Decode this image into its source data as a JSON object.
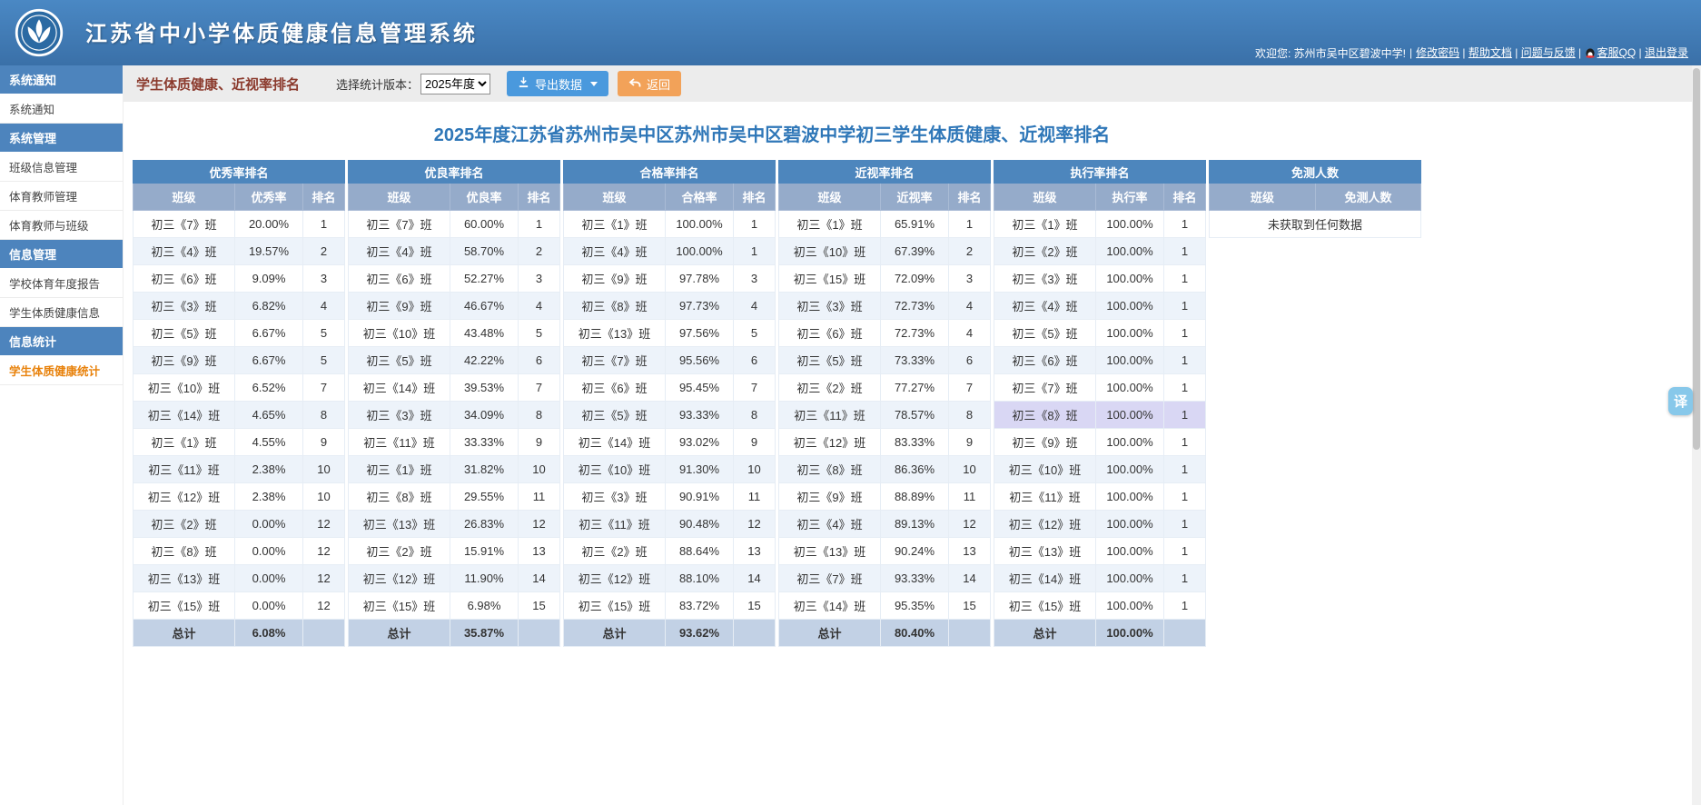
{
  "header": {
    "app_title": "江苏省中小学体质健康信息管理系统",
    "welcome": "欢迎您: 苏州市吴中区碧波中学!",
    "links": [
      "修改密码",
      "帮助文档",
      "问题与反馈",
      "客服QQ",
      "退出登录"
    ]
  },
  "sidebar": {
    "items": [
      {
        "label": "系统通知",
        "type": "group"
      },
      {
        "label": "系统通知",
        "type": "item"
      },
      {
        "label": "系统管理",
        "type": "group"
      },
      {
        "label": "班级信息管理",
        "type": "item"
      },
      {
        "label": "体育教师管理",
        "type": "item"
      },
      {
        "label": "体育教师与班级",
        "type": "item"
      },
      {
        "label": "信息管理",
        "type": "group"
      },
      {
        "label": "学校体育年度报告",
        "type": "item"
      },
      {
        "label": "学生体质健康信息",
        "type": "item"
      },
      {
        "label": "信息统计",
        "type": "group"
      },
      {
        "label": "学生体质健康统计",
        "type": "item",
        "active": true
      }
    ]
  },
  "toolbar": {
    "page_title": "学生体质健康、近视率排名",
    "version_label": "选择统计版本：",
    "version_options": [
      "2025年度"
    ],
    "version_value": "2025年度",
    "export_button": "导出数据",
    "back_button": "返回"
  },
  "main": {
    "report_title": "2025年度江苏省苏州市吴中区苏州市吴中区碧波中学初三学生体质健康、近视率排名",
    "tables": [
      {
        "title": "优秀率排名",
        "columns": [
          "班级",
          "优秀率",
          "排名"
        ],
        "rows": [
          [
            "初三《7》班",
            "20.00%",
            "1"
          ],
          [
            "初三《4》班",
            "19.57%",
            "2"
          ],
          [
            "初三《6》班",
            "9.09%",
            "3"
          ],
          [
            "初三《3》班",
            "6.82%",
            "4"
          ],
          [
            "初三《5》班",
            "6.67%",
            "5"
          ],
          [
            "初三《9》班",
            "6.67%",
            "5"
          ],
          [
            "初三《10》班",
            "6.52%",
            "7"
          ],
          [
            "初三《14》班",
            "4.65%",
            "8"
          ],
          [
            "初三《1》班",
            "4.55%",
            "9"
          ],
          [
            "初三《11》班",
            "2.38%",
            "10"
          ],
          [
            "初三《12》班",
            "2.38%",
            "10"
          ],
          [
            "初三《2》班",
            "0.00%",
            "12"
          ],
          [
            "初三《8》班",
            "0.00%",
            "12"
          ],
          [
            "初三《13》班",
            "0.00%",
            "12"
          ],
          [
            "初三《15》班",
            "0.00%",
            "12"
          ]
        ],
        "total": [
          "总计",
          "6.08%",
          ""
        ]
      },
      {
        "title": "优良率排名",
        "columns": [
          "班级",
          "优良率",
          "排名"
        ],
        "rows": [
          [
            "初三《7》班",
            "60.00%",
            "1"
          ],
          [
            "初三《4》班",
            "58.70%",
            "2"
          ],
          [
            "初三《6》班",
            "52.27%",
            "3"
          ],
          [
            "初三《9》班",
            "46.67%",
            "4"
          ],
          [
            "初三《10》班",
            "43.48%",
            "5"
          ],
          [
            "初三《5》班",
            "42.22%",
            "6"
          ],
          [
            "初三《14》班",
            "39.53%",
            "7"
          ],
          [
            "初三《3》班",
            "34.09%",
            "8"
          ],
          [
            "初三《11》班",
            "33.33%",
            "9"
          ],
          [
            "初三《1》班",
            "31.82%",
            "10"
          ],
          [
            "初三《8》班",
            "29.55%",
            "11"
          ],
          [
            "初三《13》班",
            "26.83%",
            "12"
          ],
          [
            "初三《2》班",
            "15.91%",
            "13"
          ],
          [
            "初三《12》班",
            "11.90%",
            "14"
          ],
          [
            "初三《15》班",
            "6.98%",
            "15"
          ]
        ],
        "total": [
          "总计",
          "35.87%",
          ""
        ]
      },
      {
        "title": "合格率排名",
        "columns": [
          "班级",
          "合格率",
          "排名"
        ],
        "rows": [
          [
            "初三《1》班",
            "100.00%",
            "1"
          ],
          [
            "初三《4》班",
            "100.00%",
            "1"
          ],
          [
            "初三《9》班",
            "97.78%",
            "3"
          ],
          [
            "初三《8》班",
            "97.73%",
            "4"
          ],
          [
            "初三《13》班",
            "97.56%",
            "5"
          ],
          [
            "初三《7》班",
            "95.56%",
            "6"
          ],
          [
            "初三《6》班",
            "95.45%",
            "7"
          ],
          [
            "初三《5》班",
            "93.33%",
            "8"
          ],
          [
            "初三《14》班",
            "93.02%",
            "9"
          ],
          [
            "初三《10》班",
            "91.30%",
            "10"
          ],
          [
            "初三《3》班",
            "90.91%",
            "11"
          ],
          [
            "初三《11》班",
            "90.48%",
            "12"
          ],
          [
            "初三《2》班",
            "88.64%",
            "13"
          ],
          [
            "初三《12》班",
            "88.10%",
            "14"
          ],
          [
            "初三《15》班",
            "83.72%",
            "15"
          ]
        ],
        "total": [
          "总计",
          "93.62%",
          ""
        ]
      },
      {
        "title": "近视率排名",
        "columns": [
          "班级",
          "近视率",
          "排名"
        ],
        "rows": [
          [
            "初三《1》班",
            "65.91%",
            "1"
          ],
          [
            "初三《10》班",
            "67.39%",
            "2"
          ],
          [
            "初三《15》班",
            "72.09%",
            "3"
          ],
          [
            "初三《3》班",
            "72.73%",
            "4"
          ],
          [
            "初三《6》班",
            "72.73%",
            "4"
          ],
          [
            "初三《5》班",
            "73.33%",
            "6"
          ],
          [
            "初三《2》班",
            "77.27%",
            "7"
          ],
          [
            "初三《11》班",
            "78.57%",
            "8"
          ],
          [
            "初三《12》班",
            "83.33%",
            "9"
          ],
          [
            "初三《8》班",
            "86.36%",
            "10"
          ],
          [
            "初三《9》班",
            "88.89%",
            "11"
          ],
          [
            "初三《4》班",
            "89.13%",
            "12"
          ],
          [
            "初三《13》班",
            "90.24%",
            "13"
          ],
          [
            "初三《7》班",
            "93.33%",
            "14"
          ],
          [
            "初三《14》班",
            "95.35%",
            "15"
          ]
        ],
        "total": [
          "总计",
          "80.40%",
          ""
        ]
      },
      {
        "title": "执行率排名",
        "columns": [
          "班级",
          "执行率",
          "排名"
        ],
        "highlight_row": 7,
        "rows": [
          [
            "初三《1》班",
            "100.00%",
            "1"
          ],
          [
            "初三《2》班",
            "100.00%",
            "1"
          ],
          [
            "初三《3》班",
            "100.00%",
            "1"
          ],
          [
            "初三《4》班",
            "100.00%",
            "1"
          ],
          [
            "初三《5》班",
            "100.00%",
            "1"
          ],
          [
            "初三《6》班",
            "100.00%",
            "1"
          ],
          [
            "初三《7》班",
            "100.00%",
            "1"
          ],
          [
            "初三《8》班",
            "100.00%",
            "1"
          ],
          [
            "初三《9》班",
            "100.00%",
            "1"
          ],
          [
            "初三《10》班",
            "100.00%",
            "1"
          ],
          [
            "初三《11》班",
            "100.00%",
            "1"
          ],
          [
            "初三《12》班",
            "100.00%",
            "1"
          ],
          [
            "初三《13》班",
            "100.00%",
            "1"
          ],
          [
            "初三《14》班",
            "100.00%",
            "1"
          ],
          [
            "初三《15》班",
            "100.00%",
            "1"
          ]
        ],
        "total": [
          "总计",
          "100.00%",
          ""
        ]
      },
      {
        "title": "免测人数",
        "columns": [
          "班级",
          "免测人数"
        ],
        "rows": [],
        "no_data": "未获取到任何数据"
      }
    ]
  },
  "floating": {
    "translate_label": "译"
  },
  "colors": {
    "header_blue_top": "#4a88c4",
    "header_blue_bottom": "#3a70a8",
    "group_blue": "#4d84bd",
    "table_title_blue": "#4d86bd",
    "column_header_blue": "#95abca",
    "row_alt_blue": "#edf3fa",
    "total_row_blue": "#c2d1e5",
    "highlight_purple": "#d9d7f4",
    "active_orange": "#e8820c",
    "export_button_blue": "#4a99dd",
    "back_button_orange": "#f2a259",
    "report_title_blue": "#2f77b8",
    "page_title_maroon": "#8b3a2d"
  }
}
